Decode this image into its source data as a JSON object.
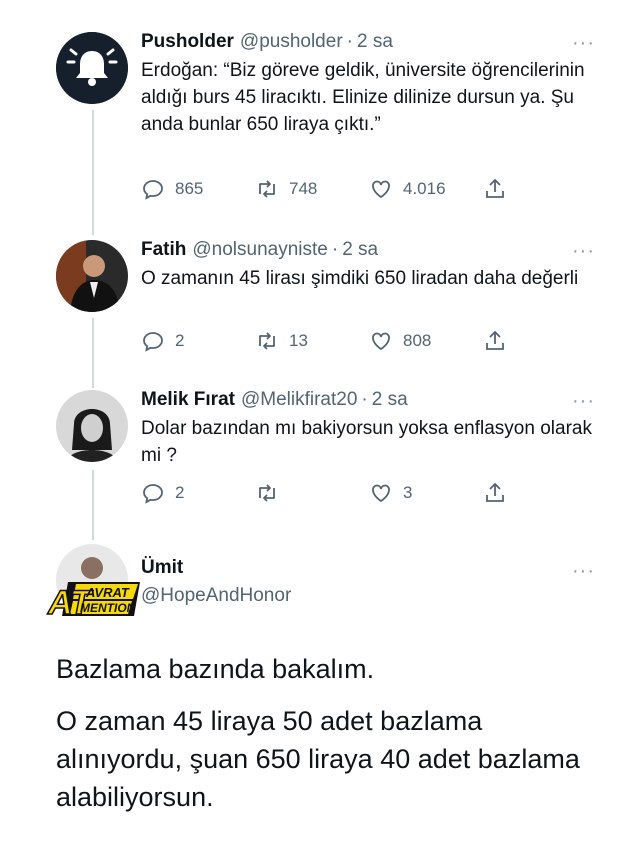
{
  "tweets": [
    {
      "name": "Pusholder",
      "handle": "@pusholder",
      "time": "2 sa",
      "text": "Erdoğan: “Biz göreve geldik, üniversite öğrencilerinin aldığı burs 45 liracıktı. Elinize dilinize dursun ya. Şu anda bunlar 650 liraya çıktı.”",
      "replies": "865",
      "retweets": "748",
      "likes": "4.016"
    },
    {
      "name": "Fatih",
      "handle": "@nolsunayniste",
      "time": "2 sa",
      "text": "O zamanın 45 lirası şimdiki 650 liradan daha değerli",
      "replies": "2",
      "retweets": "13",
      "likes": "808"
    },
    {
      "name": "Melik Fırat",
      "handle": "@Melikfirat20",
      "time": "2 sa",
      "text": "Dolar bazından mı bakiyorsun yoksa enflasyon olarak mi ?",
      "replies": "2",
      "retweets": "",
      "likes": "3"
    }
  ],
  "final_tweet": {
    "name": "Ümit",
    "handle": "@HopeAndHonor",
    "paragraph1": "Bazlama bazında bakalım.",
    "paragraph2": "O zaman 45 liraya 50 adet bazlama alınıyordu, şuan 650 liraya 40 adet bazlama alabiliyorsun."
  },
  "watermark": {
    "big": "AT",
    "top": "AVRAT",
    "bottom": "MENTION"
  },
  "more_glyph": "···",
  "dot_glyph": "·",
  "colors": {
    "text": "#0f1419",
    "muted": "#536471",
    "thread": "#cfd9de",
    "logo_yellow": "#f5d90a"
  },
  "icons": [
    "bell-icon",
    "reply-icon",
    "retweet-icon",
    "like-icon",
    "share-icon",
    "more-icon"
  ]
}
